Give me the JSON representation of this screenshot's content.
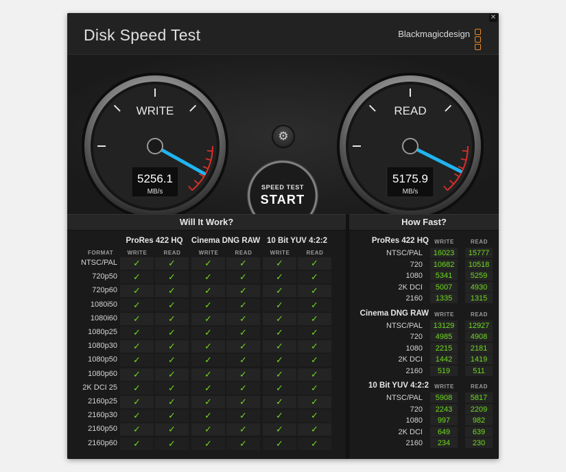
{
  "window": {
    "title": "Disk Speed Test",
    "brand": "Blackmagicdesign",
    "close_glyph": "✕"
  },
  "gauges": {
    "write": {
      "label": "WRITE",
      "value": "5256.1",
      "unit": "MB/s",
      "needle_level": 0.92
    },
    "read": {
      "label": "READ",
      "value": "5175.9",
      "unit": "MB/s",
      "needle_level": 0.91
    }
  },
  "start_button": {
    "line1": "SPEED TEST",
    "line2": "START"
  },
  "settings_icon": "gear-icon",
  "colors": {
    "accent_needle": "#1fb5f0",
    "check_green": "#6edc1e",
    "redline": "#d9302a",
    "brand_orange": "#f08a24"
  },
  "will_it_work": {
    "title": "Will It Work?",
    "format_header": "FORMAT",
    "groups": [
      "ProRes 422 HQ",
      "Cinema DNG RAW",
      "10 Bit YUV 4:2:2"
    ],
    "col_headers": [
      "WRITE",
      "READ"
    ],
    "check_glyph": "✓",
    "rows": [
      "NTSC/PAL",
      "720p50",
      "720p60",
      "1080i50",
      "1080i60",
      "1080p25",
      "1080p30",
      "1080p50",
      "1080p60",
      "2K DCI 25",
      "2160p25",
      "2160p30",
      "2160p50",
      "2160p60"
    ]
  },
  "how_fast": {
    "title": "How Fast?",
    "col_headers": [
      "WRITE",
      "READ"
    ],
    "groups": [
      {
        "name": "ProRes 422 HQ",
        "rows": [
          {
            "label": "NTSC/PAL",
            "write": "16023",
            "read": "15777"
          },
          {
            "label": "720",
            "write": "10682",
            "read": "10518"
          },
          {
            "label": "1080",
            "write": "5341",
            "read": "5259"
          },
          {
            "label": "2K DCI",
            "write": "5007",
            "read": "4930"
          },
          {
            "label": "2160",
            "write": "1335",
            "read": "1315"
          }
        ]
      },
      {
        "name": "Cinema DNG RAW",
        "rows": [
          {
            "label": "NTSC/PAL",
            "write": "13129",
            "read": "12927"
          },
          {
            "label": "720",
            "write": "4985",
            "read": "4908"
          },
          {
            "label": "1080",
            "write": "2215",
            "read": "2181"
          },
          {
            "label": "2K DCI",
            "write": "1442",
            "read": "1419"
          },
          {
            "label": "2160",
            "write": "519",
            "read": "511"
          }
        ]
      },
      {
        "name": "10 Bit YUV 4:2:2",
        "rows": [
          {
            "label": "NTSC/PAL",
            "write": "5908",
            "read": "5817"
          },
          {
            "label": "720",
            "write": "2243",
            "read": "2209"
          },
          {
            "label": "1080",
            "write": "997",
            "read": "982"
          },
          {
            "label": "2K DCI",
            "write": "649",
            "read": "639"
          },
          {
            "label": "2160",
            "write": "234",
            "read": "230"
          }
        ]
      }
    ]
  }
}
